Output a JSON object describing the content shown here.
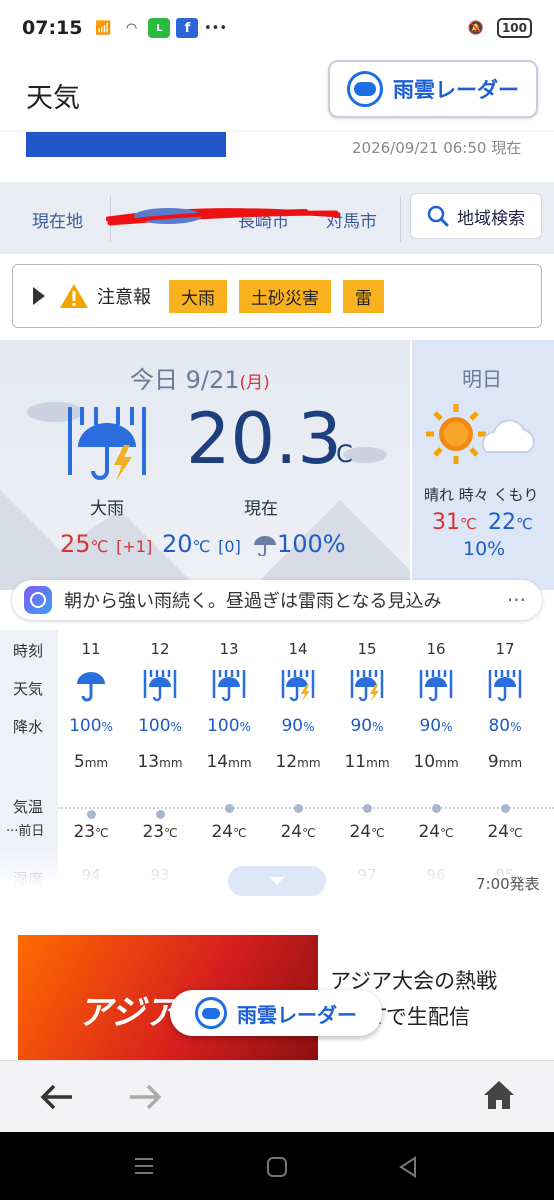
{
  "status": {
    "time": "07:15",
    "battery": "100"
  },
  "header": {
    "title": "天気",
    "radar_label": "雨雲レーダー"
  },
  "map": {
    "updated": "2026/09/21 06:50 現在"
  },
  "locations": {
    "current": "現在地",
    "item2": "長崎市",
    "item3": "対馬市",
    "search": "地域検索"
  },
  "warning": {
    "label": "注意報",
    "tags": [
      "大雨",
      "土砂災害",
      "雷"
    ]
  },
  "today": {
    "label": "今日 9/21",
    "weekday": "(月)",
    "temp_now": "20.3",
    "temp_unit": "℃",
    "weather": "大雨",
    "now_label": "現在",
    "high": "25",
    "high_diff": "[+1]",
    "low": "20",
    "low_diff": "[0]",
    "pop": "100%"
  },
  "tomorrow": {
    "title": "明日",
    "weather": "晴れ 時々 くもり",
    "high": "31",
    "low": "22",
    "pop": "10%"
  },
  "comment": {
    "text": "朝から強い雨続く。昼過ぎは雷雨となる見込み",
    "more": "···"
  },
  "hourly": {
    "row_labels": {
      "time": "時刻",
      "weather": "天気",
      "precip": "降水",
      "temp": "気温",
      "prev": "···前日",
      "humidity": "湿度"
    },
    "hours": [
      {
        "h": "11",
        "icon": "umbrella-icon",
        "pop": "100",
        "mm": "5",
        "temp": "23",
        "hum": "94"
      },
      {
        "h": "12",
        "icon": "heavy-rain-icon",
        "pop": "100",
        "mm": "13",
        "temp": "23",
        "hum": "93"
      },
      {
        "h": "13",
        "icon": "heavy-rain-icon",
        "pop": "100",
        "mm": "14",
        "temp": "24",
        "hum": ""
      },
      {
        "h": "14",
        "icon": "thunder-rain-icon",
        "pop": "90",
        "mm": "12",
        "temp": "24",
        "hum": ""
      },
      {
        "h": "15",
        "icon": "thunder-rain-icon",
        "pop": "90",
        "mm": "11",
        "temp": "24",
        "hum": "97"
      },
      {
        "h": "16",
        "icon": "heavy-rain-icon",
        "pop": "90",
        "mm": "10",
        "temp": "24",
        "hum": "96"
      },
      {
        "h": "17",
        "icon": "heavy-rain-icon",
        "pop": "80",
        "mm": "9",
        "temp": "24",
        "hum": "95"
      }
    ],
    "pct_unit": "%",
    "mm_unit": "mm",
    "temp_unit": "℃",
    "issued": "7:00発表"
  },
  "ad": {
    "headline": "アジア大会の熱戦 NEXTで生配信",
    "image_text": "アジア"
  },
  "colors": {
    "accent": "#1d5fd6",
    "warning": "#f9b21d",
    "high": "#d63636",
    "low": "#1f5cc4"
  }
}
